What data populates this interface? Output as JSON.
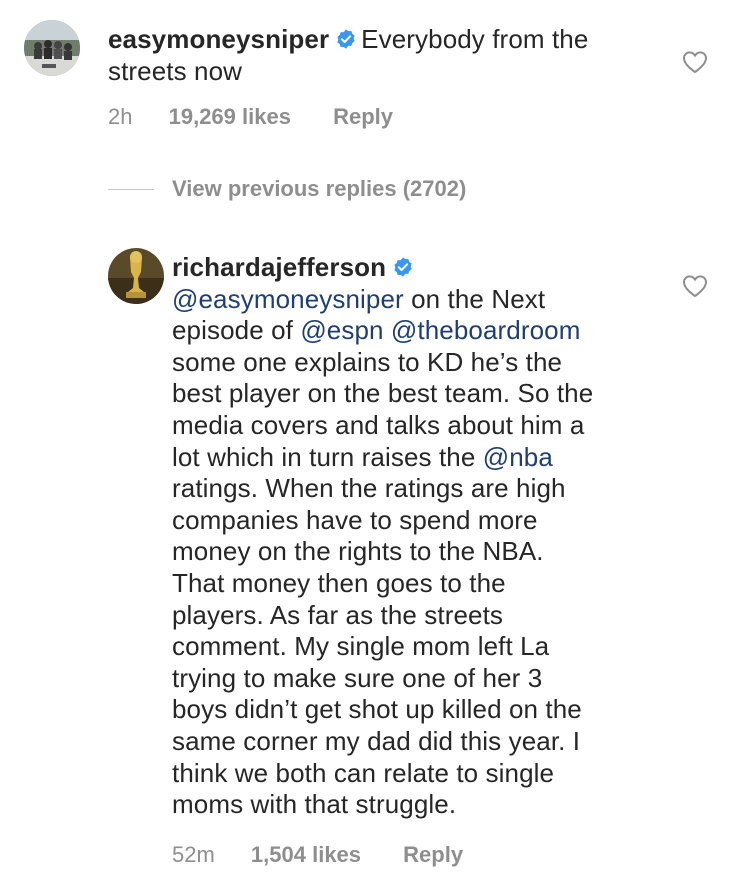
{
  "comments": [
    {
      "username": "easymoneysniper",
      "text": "Everybody from the",
      "text2": "streets now",
      "time": "2h",
      "likes": "19,269 likes",
      "reply_label": "Reply"
    },
    {
      "username": "richardajefferson",
      "mention1": "@easymoneysniper",
      "line1_rest": " on the Next",
      "line2_pre": "episode of ",
      "mention2": "@espn",
      "mention3": "@theboardroom",
      "line3": "some one explains to KD he’s the",
      "line4": "best player on the best team. So the",
      "line5": "media covers and talks about him a",
      "line6_pre": "lot which in turn raises the ",
      "mention4": "@nba",
      "line7": "ratings. When the ratings are high",
      "line8": "companies have to spend more",
      "line9": "money on the rights to the NBA.",
      "line10": "That money then goes to the",
      "line11": "players. As far as the streets",
      "line12": "comment. My single mom left La",
      "line13": "trying to make sure one of her  3",
      "line14": "boys didn’t get shot up killed on the",
      "line15": "same corner my dad did  this year. I",
      "line16": "think we both can relate to single",
      "line17": "moms with that struggle.",
      "time": "52m",
      "likes": "1,504 likes",
      "reply_label": "Reply"
    }
  ],
  "view_previous": "View previous replies (2702)",
  "icons": {
    "verified": "verified-badge-icon",
    "heart": "heart-outline-icon"
  },
  "colors": {
    "mention": "#1f3f74",
    "verified": "#3897f0",
    "meta": "#8e8e8e"
  }
}
